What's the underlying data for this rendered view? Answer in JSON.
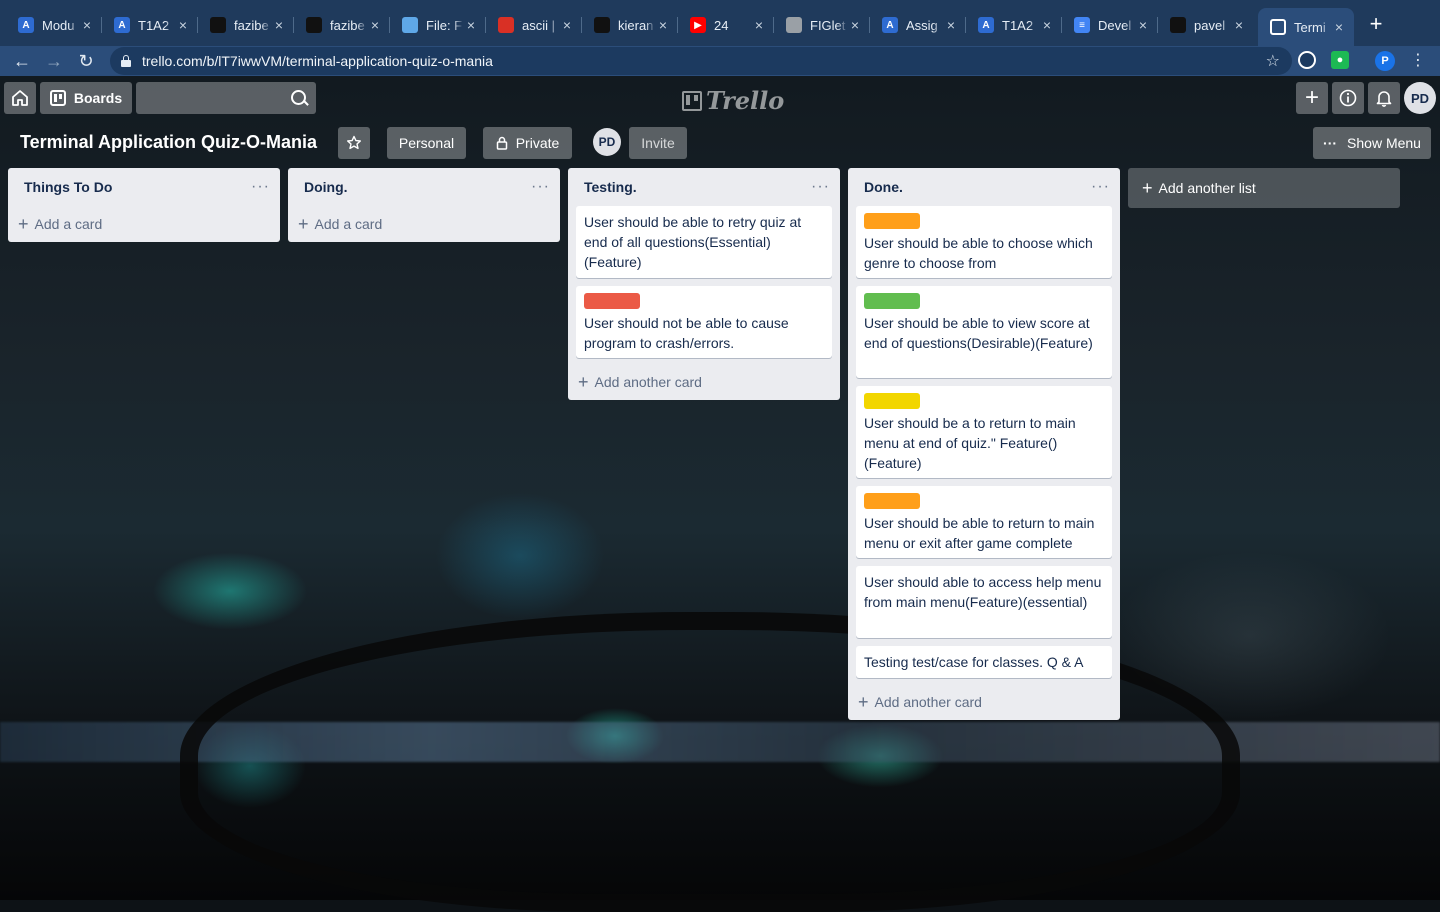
{
  "browser": {
    "tabs": [
      {
        "title": "Modu",
        "fav_color": "#2e6bd1",
        "fav_char": "A"
      },
      {
        "title": "T1A2",
        "fav_color": "#2e6bd1",
        "fav_char": "A"
      },
      {
        "title": "fazibe",
        "fav_color": "#111111",
        "fav_char": ""
      },
      {
        "title": "fazibe",
        "fav_color": "#111111",
        "fav_char": ""
      },
      {
        "title": "File: F",
        "fav_color": "#5fa8e8",
        "fav_char": ""
      },
      {
        "title": "ascii |",
        "fav_color": "#d93025",
        "fav_char": ""
      },
      {
        "title": "kieran",
        "fav_color": "#111111",
        "fav_char": ""
      },
      {
        "title": "24",
        "fav_color": "#ff0000",
        "fav_char": "▶"
      },
      {
        "title": "FIGlet",
        "fav_color": "#9aa0a6",
        "fav_char": ""
      },
      {
        "title": "Assig",
        "fav_color": "#2e6bd1",
        "fav_char": "A"
      },
      {
        "title": "T1A2",
        "fav_color": "#2e6bd1",
        "fav_char": "A"
      },
      {
        "title": "Devel",
        "fav_color": "#4285f4",
        "fav_char": "≡"
      },
      {
        "title": "pavel",
        "fav_color": "#111111",
        "fav_char": ""
      },
      {
        "title": "Termi",
        "fav_color": "#ffffff",
        "fav_char": ""
      }
    ],
    "url": "trello.com/b/lT7iwwVM/terminal-application-quiz-o-mania",
    "profile_initial": "P"
  },
  "header": {
    "boards_label": "Boards",
    "logo_text": "Trello",
    "avatar": "PD"
  },
  "board": {
    "title": "Terminal Application Quiz-O-Mania",
    "team_label": "Personal",
    "visibility_label": "Private",
    "member_avatar": "PD",
    "invite_label": "Invite",
    "show_menu_label": "Show Menu",
    "add_list_label": "Add another list"
  },
  "lists": [
    {
      "name": "Things To Do",
      "add_label": "Add a card",
      "cards": []
    },
    {
      "name": "Doing.",
      "add_label": "Add a card",
      "cards": []
    },
    {
      "name": "Testing.",
      "add_label": "Add another card",
      "cards": [
        {
          "text": "User should be able to retry quiz at end of all questions(Essential)(Feature)",
          "label": null
        },
        {
          "text": "User should not be able to cause program to crash/errors.",
          "label": "#eb5a46"
        }
      ]
    },
    {
      "name": "Done.",
      "add_label": "Add another card",
      "cards": [
        {
          "text": "User should be able to choose which genre to choose from",
          "label": "#ff9f1a"
        },
        {
          "text": "User should be able to view score at end of questions(Desirable)(Feature)",
          "label": "#61bd4f"
        },
        {
          "text": "User should be a to return to main menu at end of quiz.\" Feature()(Feature)",
          "label": "#f2d600"
        },
        {
          "text": "User should be able to return to main menu or exit after game complete",
          "label": "#ff9f1a"
        },
        {
          "text": "User should able to access help menu from main menu(Feature)(essential)",
          "label": null
        },
        {
          "text": "Testing test/case for classes. Q & A",
          "label": null
        }
      ]
    }
  ]
}
